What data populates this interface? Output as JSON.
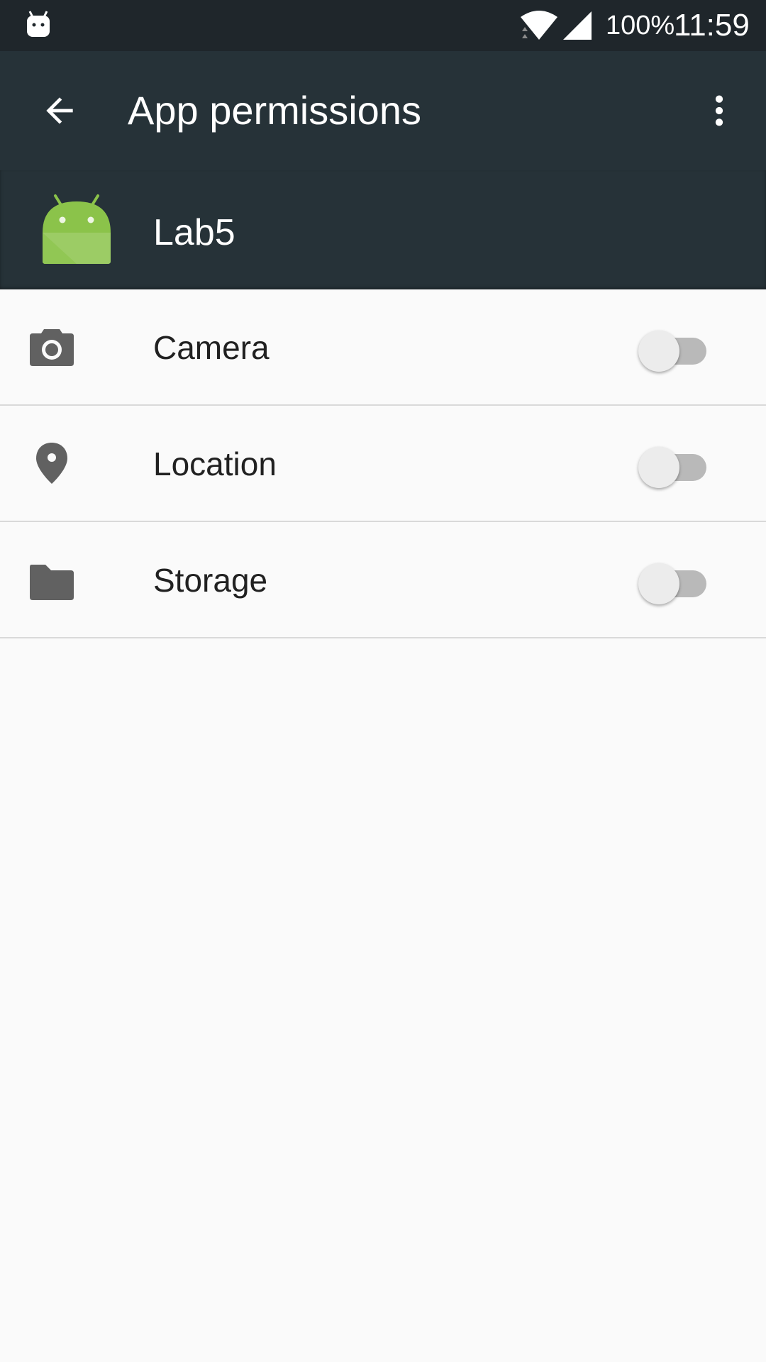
{
  "status_bar": {
    "notification_icon": "android-notification-icon",
    "wifi_icon": "wifi-icon",
    "signal_icon": "signal-icon",
    "battery": "100%",
    "time": "11:59"
  },
  "app_bar": {
    "back_icon": "arrow-back-icon",
    "title": "App permissions",
    "overflow_icon": "more-vert-icon"
  },
  "app_header": {
    "app_icon": "android-app-icon",
    "app_name": "Lab5"
  },
  "permissions": [
    {
      "label": "Camera",
      "icon": "camera-icon",
      "enabled": false
    },
    {
      "label": "Location",
      "icon": "location-pin-icon",
      "enabled": false
    },
    {
      "label": "Storage",
      "icon": "folder-icon",
      "enabled": false
    }
  ],
  "colors": {
    "status_bar_bg": "#1f262b",
    "app_bar_bg": "#263238",
    "android_green": "#8bc34a",
    "icon_grey": "#616161"
  }
}
